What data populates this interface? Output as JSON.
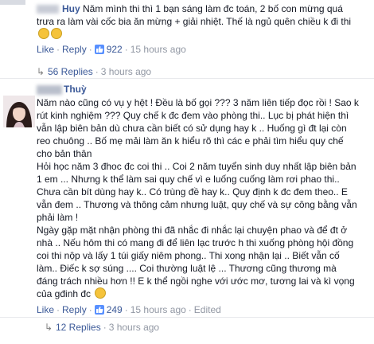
{
  "comment1": {
    "author": "Huy",
    "text": "Năm mình thi thì 1 bạn sáng làm đc toán, 2 bố con mừng quá trưa ra làm vài cốc bia ăn mừng + giải nhiệt. Thế là ngủ quên chiều k đi thi",
    "like_label": "Like",
    "reply_label": "Reply",
    "like_count": "922",
    "time": "15 hours ago"
  },
  "replies1": {
    "count_text": "56 Replies",
    "time": "3 hours ago"
  },
  "comment2": {
    "author": "Thuỳ",
    "paragraphs": [
      "Năm nào cũng có vụ y hệt ! Đều là bố gọi ??? 3 năm liên tiếp đọc rồi ! Sao k rút kinh nghiệm ??? Quy chế k đc đem vào phòng thi.. Lục bị phát hiện thì vẫn lập biên bản dù chưa cần biết có sử dụng hay k .. Huống gì đt lại còn reo chuông .. Bố mẹ mải làm ăn k hiểu rõ thì các e phải tìm hiểu quy chế cho bản thân",
      "Hỏi học năm 3 đhoc đc coi thi .. Coi 2 năm tuyển sinh duy nhất lập biên bản 1 em ... Nhưng k thể làm sai quy chế vì e luống cuống làm rơi phao thi.. Chưa cần bít dùng hay k.. Có trùng đề hay k.. Quy định k đc đem theo.. E vẫn đem .. Thương và thông cảm nhưng luật, quy chế và sự công bằng vẫn phải làm !",
      "Ngày gặp mặt nhận phòng thi đã nhắc đi nhắc lại chuyện phao và để đt ở nhà .. Nếu hôm thi có mang đi để liên lạc trước h thi xuống phòng hội đồng coi thi nộp và lấy 1 túi giấy niêm phong.. Thi xong nhận lại .. Biết vẫn cố làm.. Điếc k sợ súng .... Coi thường luật lệ ... Thương cũng thương mà đáng trách nhiều hơn !! E k thể ngồi nghe với ước mơ, tương lai và kì vọng của gđinh đc"
    ],
    "like_label": "Like",
    "reply_label": "Reply",
    "like_count": "249",
    "time": "15 hours ago",
    "edited": "Edited"
  },
  "replies2": {
    "count_text": "12 Replies",
    "time": "3 hours ago"
  }
}
